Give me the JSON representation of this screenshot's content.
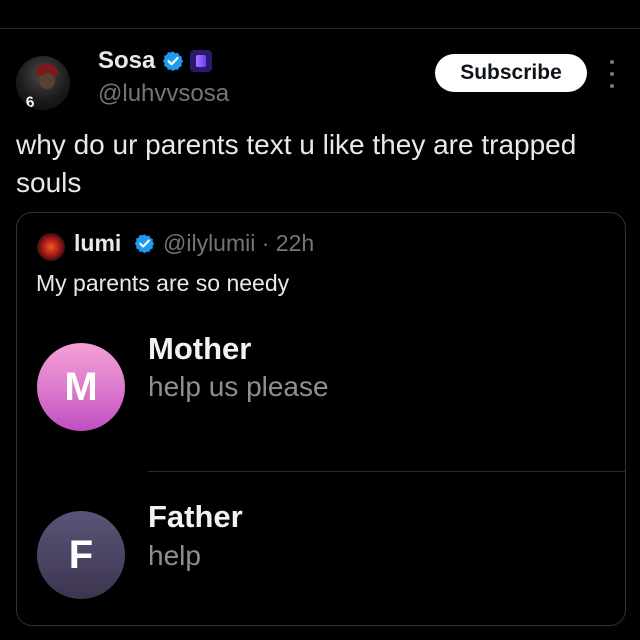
{
  "author": {
    "name": "Sosa",
    "handle": "@luhvvsosa",
    "avatar_jersey": "6",
    "verified_color": "#1d9bf0"
  },
  "subscribe_label": "Subscribe",
  "tweet_text": "why do ur parents text u like they are trapped souls",
  "quote": {
    "name": "lumi",
    "handle_time": "@ilylumii · 22h",
    "text": "My parents are so needy",
    "messages": [
      {
        "initial": "M",
        "name": "Mother",
        "body": "help us please",
        "avatar_color": "#e07fce"
      },
      {
        "initial": "F",
        "name": "Father",
        "body": "help",
        "avatar_color": "#4a4262"
      }
    ]
  }
}
